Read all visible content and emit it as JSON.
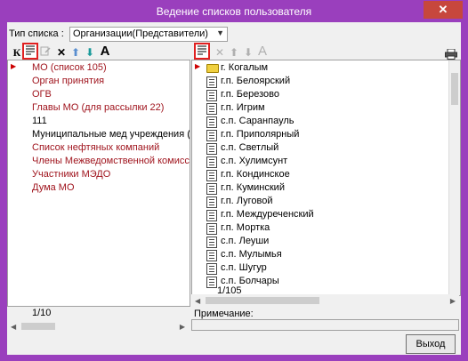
{
  "window": {
    "title": "Ведение списков пользователя",
    "close_label": "✕"
  },
  "list_type": {
    "label": "Тип списка :",
    "selected": "Организации(Представители)"
  },
  "left_toolbar": {
    "k_label": "К",
    "list_icon": "list-icon",
    "edit_icon": "edit-icon",
    "delete_label": "✕",
    "up_label": "⬆",
    "down_label": "⬇",
    "font_label": "A"
  },
  "right_toolbar": {
    "list_icon": "list-icon",
    "delete_label": "✕",
    "up_label": "⬆",
    "down_label": "⬇",
    "font_label": "A",
    "print_icon": "printer-icon"
  },
  "left_list": {
    "items": [
      {
        "label": "МО (список 105)",
        "color": "red"
      },
      {
        "label": "Орган принятия",
        "color": "red"
      },
      {
        "label": "ОГВ",
        "color": "red"
      },
      {
        "label": "Главы МО (для рассылки 22)",
        "color": "red"
      },
      {
        "label": "111",
        "color": "black"
      },
      {
        "label": "Муниципальные мед учреждения (e-mail)",
        "color": "black"
      },
      {
        "label": "Список нефтяных компаний",
        "color": "red"
      },
      {
        "label": "Члены Межведомственной комиссии по эк",
        "color": "red"
      },
      {
        "label": "Участники МЭДО",
        "color": "red"
      },
      {
        "label": "Дума МО",
        "color": "red"
      }
    ],
    "counter": "1/10"
  },
  "right_list": {
    "items": [
      {
        "label": "г. Когалым",
        "icon": "folder-icon"
      },
      {
        "label": "г.п. Белоярский",
        "icon": "doc-icon"
      },
      {
        "label": "г.п. Березово",
        "icon": "doc-icon"
      },
      {
        "label": "г.п. Игрим",
        "icon": "doc-icon"
      },
      {
        "label": "с.п. Саранпауль",
        "icon": "doc-icon"
      },
      {
        "label": "г.п. Приполярный",
        "icon": "doc-icon"
      },
      {
        "label": "с.п. Светлый",
        "icon": "doc-icon"
      },
      {
        "label": "с.п. Хулимсунт",
        "icon": "doc-icon"
      },
      {
        "label": "г.п. Кондинское",
        "icon": "doc-icon"
      },
      {
        "label": "г.п. Куминский",
        "icon": "doc-icon"
      },
      {
        "label": "г.п. Луговой",
        "icon": "doc-icon"
      },
      {
        "label": "г.п. Междуреченский",
        "icon": "doc-icon"
      },
      {
        "label": "г.п. Мортка",
        "icon": "doc-icon"
      },
      {
        "label": "с.п. Леуши",
        "icon": "doc-icon"
      },
      {
        "label": "с.п. Мулымья",
        "icon": "doc-icon"
      },
      {
        "label": "с.п. Шугур",
        "icon": "doc-icon"
      },
      {
        "label": "с.п. Болчары",
        "icon": "doc-icon"
      }
    ],
    "counter": "1/105"
  },
  "note": {
    "label": "Примечание:",
    "value": ""
  },
  "exit_button": "Выход",
  "colors": {
    "title_bar": "#9a3fbd",
    "list_red": "#a0151e",
    "highlight_border": "#e02020"
  }
}
